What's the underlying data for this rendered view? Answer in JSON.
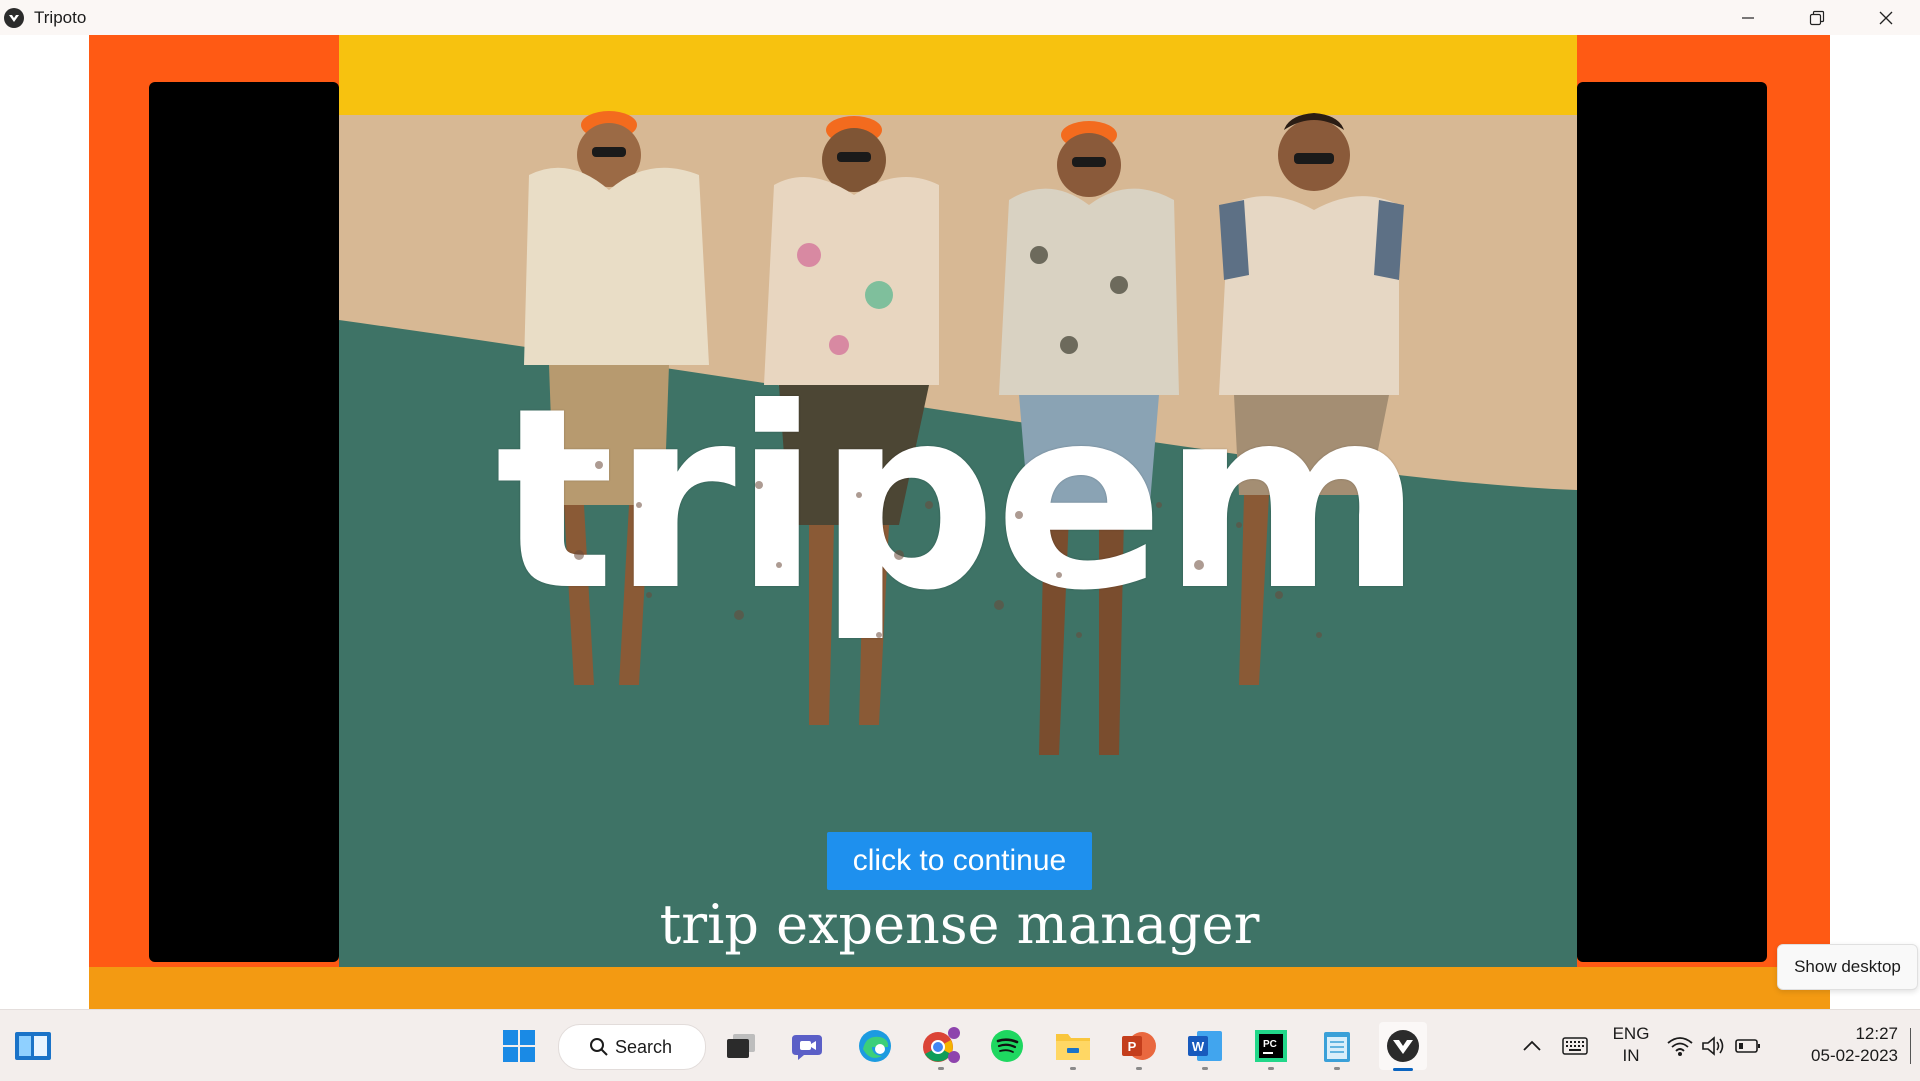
{
  "window": {
    "title": "Tripoto",
    "controls": [
      "minimize-icon",
      "restore-icon",
      "close-icon"
    ]
  },
  "splash": {
    "logo_text": "tripem",
    "continue_button": "click to continue",
    "tagline": "trip expense manager"
  },
  "tooltip": {
    "text": "Show desktop"
  },
  "taskbar": {
    "search_label": "Search",
    "apps": [
      {
        "name": "widgets-icon"
      },
      {
        "name": "start-icon"
      },
      {
        "name": "search"
      },
      {
        "name": "task-view-icon"
      },
      {
        "name": "meet-icon"
      },
      {
        "name": "edge-icon"
      },
      {
        "name": "chrome-icon"
      },
      {
        "name": "spotify-icon"
      },
      {
        "name": "file-explorer-icon"
      },
      {
        "name": "powerpoint-icon"
      },
      {
        "name": "word-icon"
      },
      {
        "name": "pycharm-icon"
      },
      {
        "name": "notepad-icon"
      },
      {
        "name": "kivy-app-icon",
        "active": true
      }
    ],
    "tray": {
      "language_line1": "ENG",
      "language_line2": "IN",
      "time": "12:27",
      "date": "05-02-2023"
    }
  },
  "colors": {
    "accent_button": "#1e90ee",
    "frame_orange": "#ff5a14",
    "teal": "#3e7366",
    "sand": "#d7b894"
  }
}
